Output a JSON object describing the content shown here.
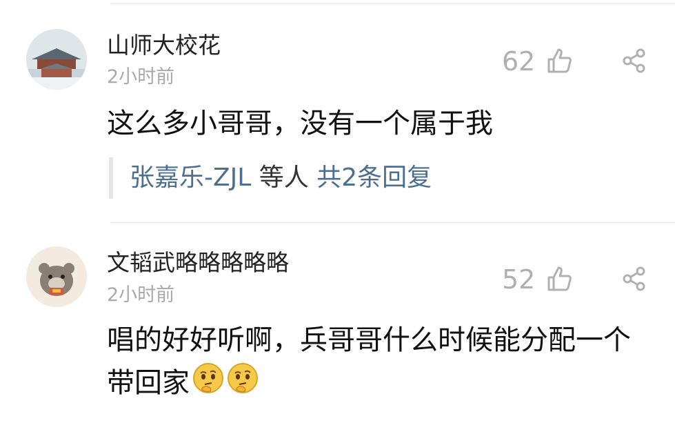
{
  "comments": [
    {
      "username": "山师大校花",
      "time": "2小时前",
      "likes": "62",
      "text": "这么多小哥哥，没有一个属于我",
      "replies": {
        "author": "张嘉乐-ZJL",
        "middle": " 等人 ",
        "count_label": "共2条回复"
      }
    },
    {
      "username": "文韬武略略略略略",
      "time": "2小时前",
      "likes": "52",
      "text": "唱的好好听啊，兵哥哥什么时候能分配一个带回家"
    }
  ],
  "icons": {
    "like": "thumbs-up-icon",
    "share": "share-icon",
    "emoji": "thinking-face-emoji"
  },
  "colors": {
    "link": "#4d6f8f",
    "muted": "#b0b0b0"
  }
}
